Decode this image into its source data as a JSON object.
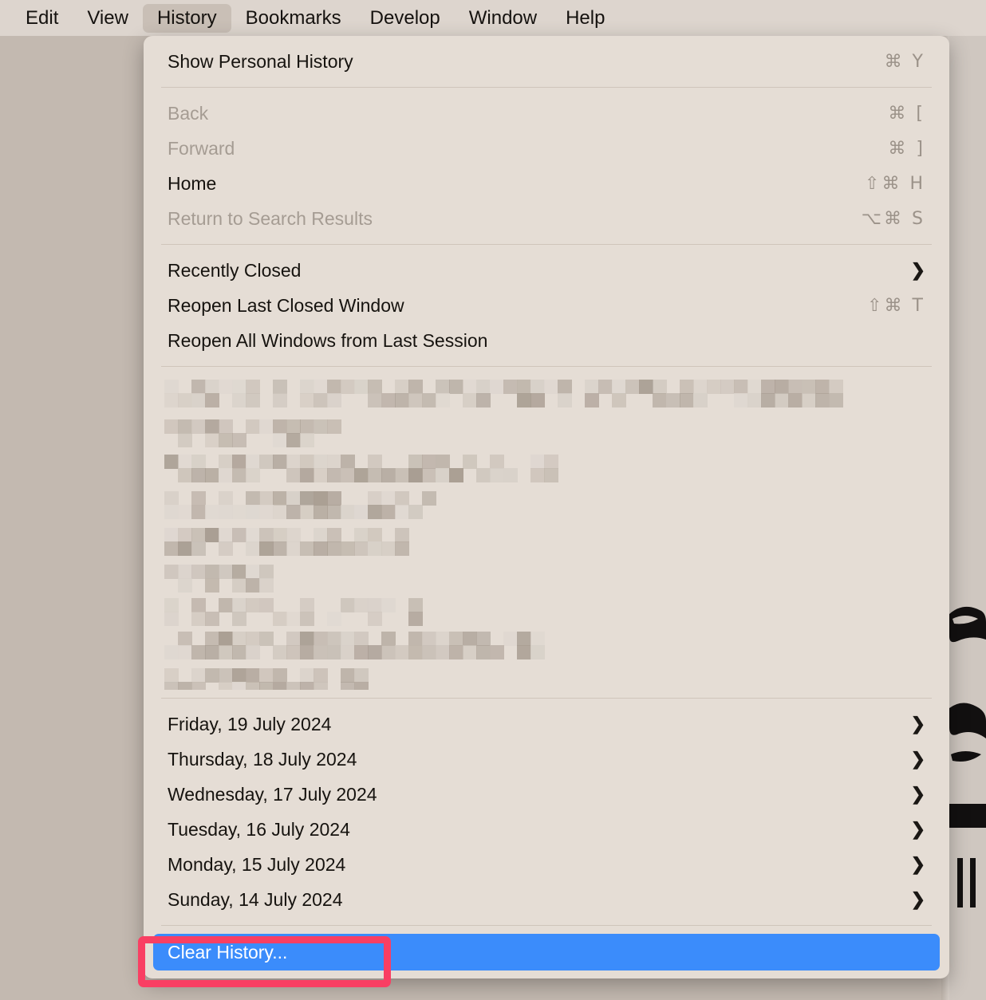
{
  "menubar": {
    "items": [
      {
        "label": "Edit",
        "active": false
      },
      {
        "label": "View",
        "active": false
      },
      {
        "label": "History",
        "active": true
      },
      {
        "label": "Bookmarks",
        "active": false
      },
      {
        "label": "Develop",
        "active": false
      },
      {
        "label": "Window",
        "active": false
      },
      {
        "label": "Help",
        "active": false
      }
    ]
  },
  "menu": {
    "group1": [
      {
        "label": "Show Personal History",
        "shortcut": "⌘ Y",
        "disabled": false,
        "submenu": false
      }
    ],
    "group2": [
      {
        "label": "Back",
        "shortcut": "⌘ [",
        "disabled": true,
        "submenu": false
      },
      {
        "label": "Forward",
        "shortcut": "⌘ ]",
        "disabled": true,
        "submenu": false
      },
      {
        "label": "Home",
        "shortcut": "⇧⌘ H",
        "disabled": false,
        "submenu": false
      },
      {
        "label": "Return to Search Results",
        "shortcut": "⌥⌘ S",
        "disabled": true,
        "submenu": false
      }
    ],
    "group3": [
      {
        "label": "Recently Closed",
        "shortcut": "",
        "disabled": false,
        "submenu": true
      },
      {
        "label": "Reopen Last Closed Window",
        "shortcut": "⇧⌘ T",
        "disabled": false,
        "submenu": false
      },
      {
        "label": "Reopen All Windows from Last Session",
        "shortcut": "",
        "disabled": false,
        "submenu": false
      }
    ],
    "redacted_note": "recent history entries (pixelated / redacted)",
    "dates": [
      {
        "label": "Friday, 19 July 2024",
        "submenu": true
      },
      {
        "label": "Thursday, 18 July 2024",
        "submenu": true
      },
      {
        "label": "Wednesday, 17 July 2024",
        "submenu": true
      },
      {
        "label": "Tuesday, 16 July 2024",
        "submenu": true
      },
      {
        "label": "Monday, 15 July 2024",
        "submenu": true
      },
      {
        "label": "Sunday, 14 July 2024",
        "submenu": true
      }
    ],
    "clear_history": {
      "label": "Clear History...",
      "highlighted": true
    }
  },
  "icons": {
    "chevron_right": "❯"
  },
  "colors": {
    "menu_background": "#e5ddd5",
    "menubar_background": "#ddd5ce",
    "desktop_background": "#c3b9b0",
    "highlight_blue": "#3b8cfb",
    "annotation_red": "#f93f63",
    "text": "#16130f",
    "text_disabled": "#a59c93",
    "shortcut_text": "#9b9289",
    "separator": "#cfc5bb"
  }
}
